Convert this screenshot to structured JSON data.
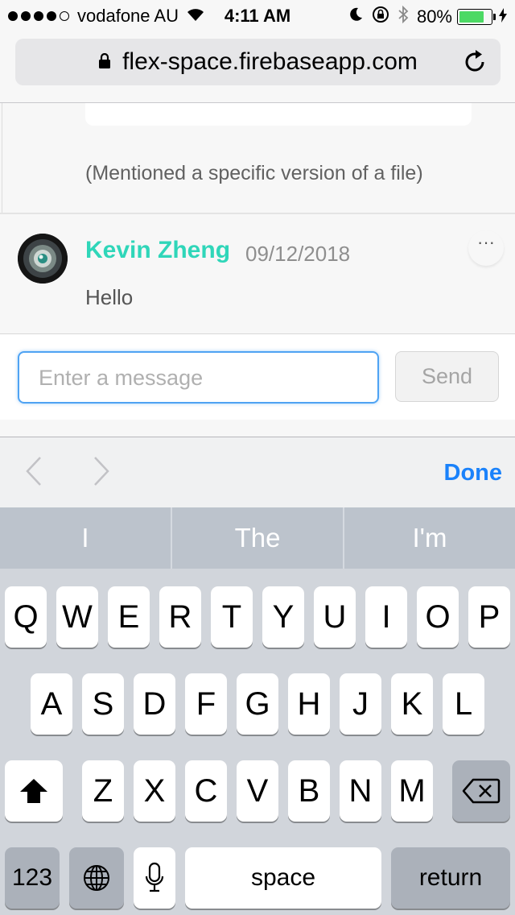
{
  "status_bar": {
    "carrier": "vodafone AU",
    "time": "4:11 AM",
    "battery": "80%",
    "battery_level": 0.8
  },
  "browser": {
    "url": "flex-space.firebaseapp.com"
  },
  "chat": {
    "mention_text": "(Mentioned a specific version of a file)",
    "message": {
      "author": "Kevin Zheng",
      "date": "09/12/2018",
      "more_label": "···",
      "body": "Hello"
    },
    "composer": {
      "placeholder": "Enter a message",
      "send_label": "Send"
    }
  },
  "keyboard_accessory": {
    "done_label": "Done"
  },
  "predictions": [
    "I",
    "The",
    "I'm"
  ],
  "keyboard": {
    "row1": [
      "Q",
      "W",
      "E",
      "R",
      "T",
      "Y",
      "U",
      "I",
      "O",
      "P"
    ],
    "row2": [
      "A",
      "S",
      "D",
      "F",
      "G",
      "H",
      "J",
      "K",
      "L"
    ],
    "row3": [
      "Z",
      "X",
      "C",
      "V",
      "B",
      "N",
      "M"
    ],
    "numbers_label": "123",
    "space_label": "space",
    "return_label": "return"
  },
  "colors": {
    "accent_teal": "#2fd6b9",
    "ios_blue": "#1a82fb",
    "input_focus": "#4fa3f3",
    "battery_green": "#4cd964"
  }
}
